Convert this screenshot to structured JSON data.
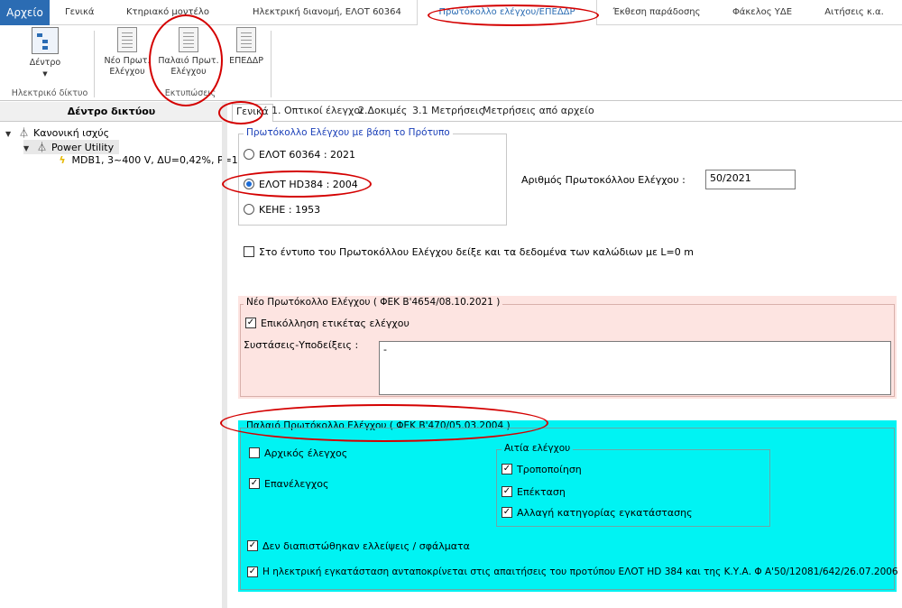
{
  "ribbon_tabs": {
    "file": "Αρχείο",
    "tabs": [
      "Γενικά",
      "Κτηριακό μοντέλο",
      "Ηλεκτρική διανομή, ΕΛΟΤ 60364",
      "Πρωτόκολλο ελέγχου/ΕΠΕΔΔΡ",
      "Έκθεση παράδοσης",
      "Φάκελος ΥΔΕ",
      "Αιτήσεις κ.α."
    ],
    "active": "Πρωτόκολλο ελέγχου/ΕΠΕΔΔΡ"
  },
  "ribbon": {
    "tree_button": "Δέντρο",
    "group1_label": "Ηλεκτρικό δίκτυο",
    "new_protocol_line1": "Νέο Πρωτ.",
    "new_protocol_line2": "Ελέγχου",
    "old_protocol_line1": "Παλαιό Πρωτ.",
    "old_protocol_line2": "Ελέγχου",
    "epeddr": "ΕΠΕΔΔΡ",
    "group2_label": "Εκτυπώσεις"
  },
  "tree": {
    "header": "Δέντρο δικτύου",
    "root": "Κανονική ισχύς",
    "child": "Power Utility",
    "leaf": "MDB1, 3~400 V, ΔU=0,42%, P=1"
  },
  "content_tabs": [
    "Γενικά",
    "1. Οπτικοί έλεγχοι",
    "2.Δοκιμές",
    "3.1 Μετρήσεις",
    "Μετρήσεις από αρχείο"
  ],
  "standard_group": {
    "title": "Πρωτόκολλο Ελέγχου με βάση το Πρότυπο",
    "options": [
      "ΕΛΟΤ 60364 : 2021",
      "ΕΛΟΤ HD384 : 2004",
      "ΚΕΗΕ : 1953"
    ],
    "selected_index": 1
  },
  "protocol_number": {
    "label": "Αριθμός Πρωτοκόλλου Ελέγχου :",
    "value": "50/2021"
  },
  "show_cables_checkbox": {
    "label": "Στο έντυπο του Πρωτοκόλλου Ελέγχου δείξε και τα δεδομένα των καλώδιων με L=0 m",
    "checked": false
  },
  "new_protocol": {
    "title": "Νέο  Πρωτόκολλο Ελέγχου ( ΦΕΚ Β'4654/08.10.2021 )",
    "sticker_label": "Επικόλληση ετικέτας ελέγχου",
    "sticker_checked": true,
    "recommendations_label": "Συστάσεις-Υποδείξεις :",
    "recommendations_value": "-",
    "background": "#fde4e1"
  },
  "old_protocol": {
    "title": "Παλαιό Πρωτόκολλο Ελέγχου ( ΦΕΚ Β'470/05.03.2004 )",
    "initial_check": "Αρχικός έλεγχος",
    "initial_checked": false,
    "recheck": "Επανέλεγχος",
    "recheck_checked": true,
    "reason_title": "Αιτία ελέγχου",
    "reasons": [
      {
        "label": "Τροποποίηση",
        "checked": true
      },
      {
        "label": "Επέκταση",
        "checked": true
      },
      {
        "label": "Αλλαγή κατηγορίας εγκατάστασης",
        "checked": true
      }
    ],
    "no_defects": "Δεν διαπιστώθηκαν ελλείψεις / σφάλματα",
    "no_defects_checked": true,
    "compliance": "Η ηλεκτρική εγκατάσταση ανταποκρίνεται στις απαιτήσεις του προτύπου ΕΛΟΤ HD 384 και της Κ.Υ.Α. Φ Α'50/12081/642/26.07.2006",
    "compliance_checked": true,
    "background": "#00f3f3"
  },
  "colors": {
    "accent": "#2b6cb3",
    "highlight_oval": "#d40000"
  }
}
